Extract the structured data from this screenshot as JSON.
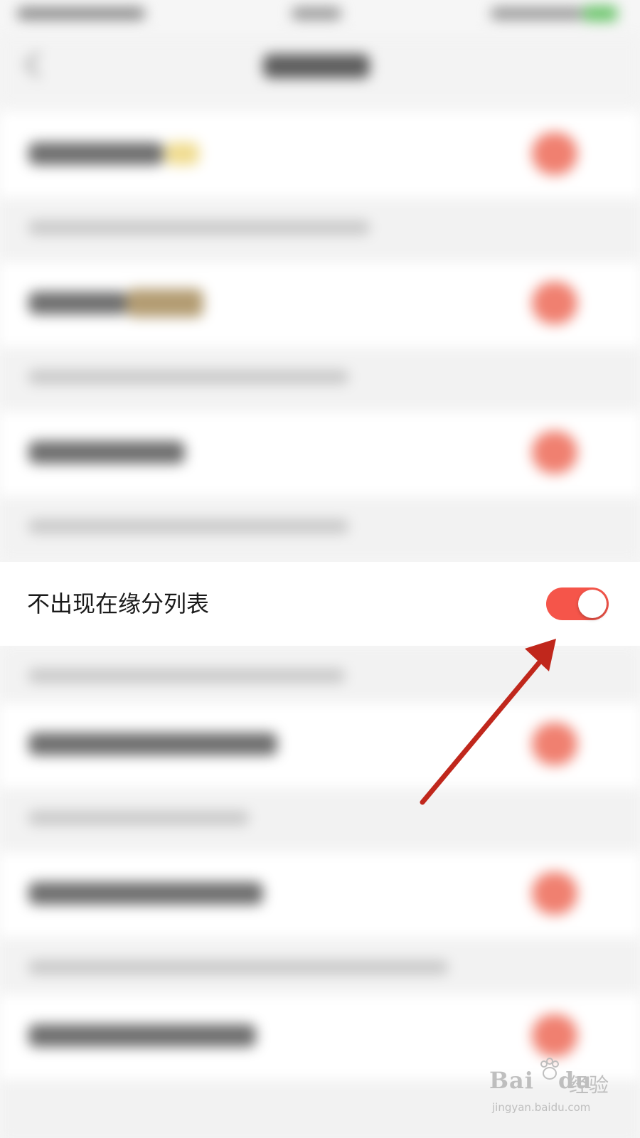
{
  "focused_setting": {
    "label": "不出现在缘分列表",
    "toggle_state": "on",
    "toggle_color": "#f5554a"
  },
  "annotation": {
    "arrow_color": "#c0271c"
  },
  "watermark": {
    "logo_text": "Bai",
    "logo_text_2": "du",
    "cn_text": "经验",
    "url": "jingyan.baidu.com"
  }
}
